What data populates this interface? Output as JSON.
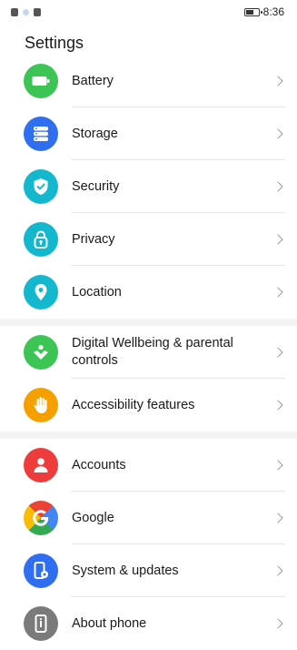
{
  "status": {
    "time": "8:36"
  },
  "header": {
    "title": "Settings"
  },
  "groups": [
    {
      "items": [
        {
          "label": "Battery",
          "icon": "battery-icon",
          "color": "#3cc455"
        },
        {
          "label": "Storage",
          "icon": "storage-icon",
          "color": "#2f6ef0"
        },
        {
          "label": "Security",
          "icon": "shield-icon",
          "color": "#13b8cf"
        },
        {
          "label": "Privacy",
          "icon": "lock-icon",
          "color": "#13b8cf"
        },
        {
          "label": "Location",
          "icon": "location-pin-icon",
          "color": "#13b8cf"
        }
      ]
    },
    {
      "items": [
        {
          "label": "Digital Wellbeing & parental controls",
          "icon": "wellbeing-icon",
          "color": "#3cc455"
        },
        {
          "label": "Accessibility features",
          "icon": "hand-icon",
          "color": "#f5a000"
        }
      ]
    },
    {
      "items": [
        {
          "label": "Accounts",
          "icon": "person-icon",
          "color": "#ee3b3b"
        },
        {
          "label": "Google",
          "icon": "google-icon",
          "color": "#4285f4"
        },
        {
          "label": "System & updates",
          "icon": "phone-settings-icon",
          "color": "#2f6ef0"
        },
        {
          "label": "About phone",
          "icon": "info-icon",
          "color": "#7a7a7a"
        }
      ]
    }
  ]
}
